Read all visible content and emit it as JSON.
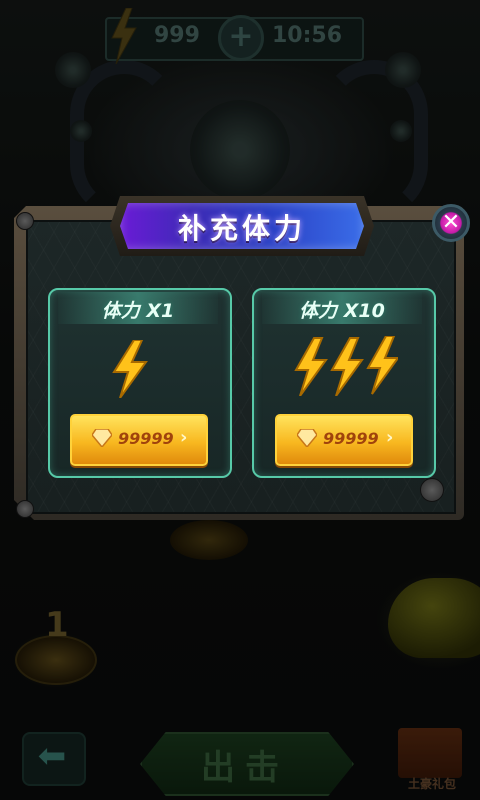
{
  "status_bar": {
    "energy_icon": "lightning-icon",
    "energy": "999",
    "add_icon": "plus-icon",
    "time": "10:56"
  },
  "dialog": {
    "title": "补充体力",
    "close_icon": "close-icon",
    "options": [
      {
        "title": "体力 X1",
        "bolt_count": 1,
        "currency_icon": "diamond-icon",
        "price": "99999"
      },
      {
        "title": "体力 X10",
        "bolt_count": 3,
        "currency_icon": "diamond-icon",
        "price": "99999"
      }
    ]
  },
  "background": {
    "level_number": "1",
    "attack_button": "出击",
    "gift_label": "土豪礼包",
    "back_icon": "back-arrow-icon"
  },
  "colors": {
    "title_bar": "#3d2bb6",
    "card_border": "#57c9a8",
    "button_gold": "#f8b820",
    "close_button": "#c41aa8"
  }
}
